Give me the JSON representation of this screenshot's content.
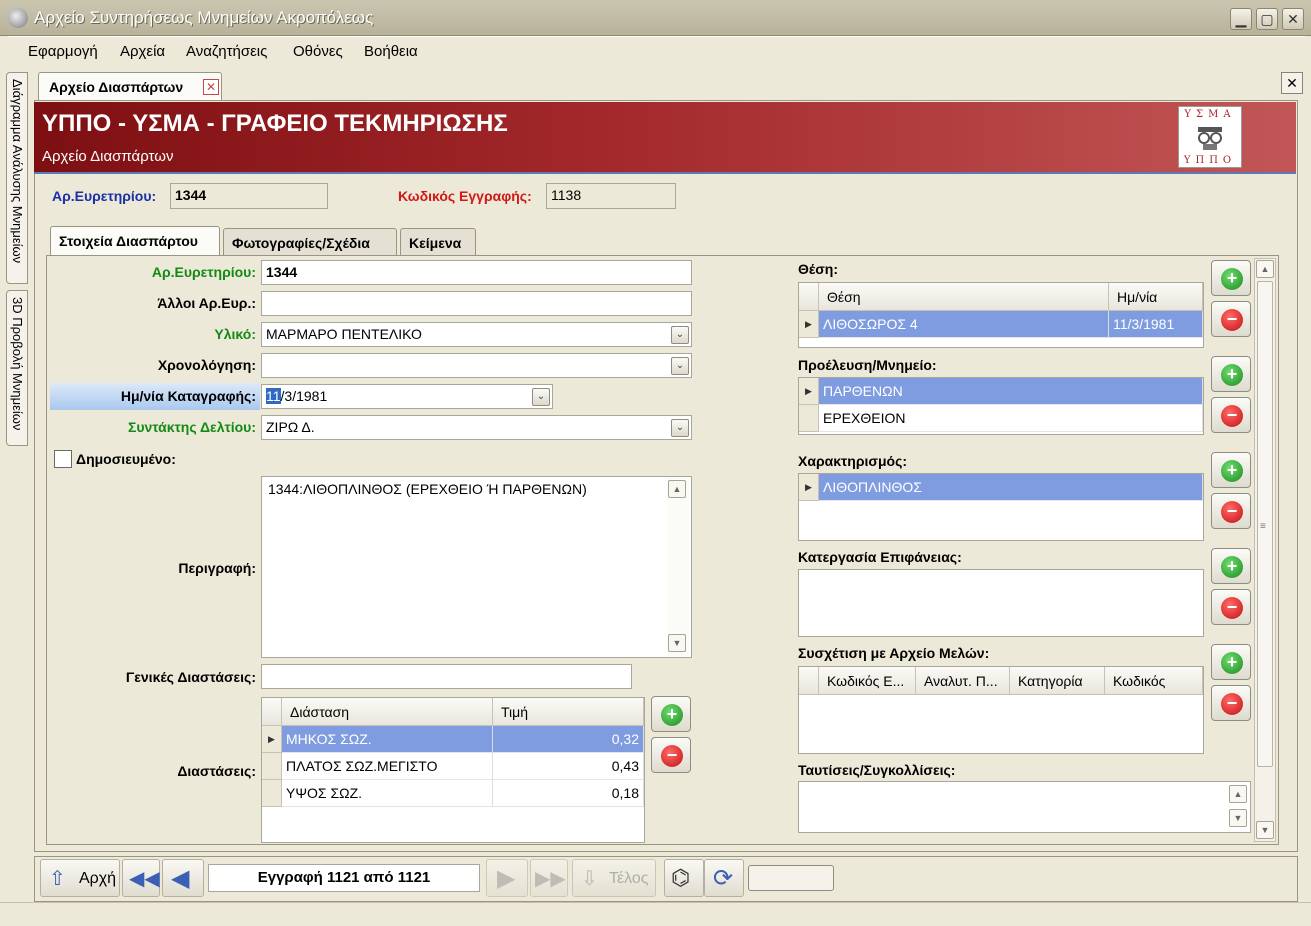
{
  "window": {
    "title": "Αρχείο Συντηρήσεως Μνημείων Ακροπόλεως",
    "minimize": "▁",
    "maximize": "▢",
    "close": "✕"
  },
  "menu": [
    "Εφαρμογή",
    "Αρχεία",
    "Αναζητήσεις",
    "Οθόνες",
    "Βοήθεια"
  ],
  "side_tabs": [
    "Διάγραμμα Ανάλυσης Μνημείων",
    "3D Προβολή Μνημείων"
  ],
  "doc_tab": {
    "label": "Αρχείο Διασπάρτων",
    "close": "✕"
  },
  "close_all": "✕",
  "banner": {
    "title": "ΥΠΠΟ - ΥΣΜΑ - ΓΡΑΦΕΙΟ ΤΕΚΜΗΡΙΩΣΗΣ",
    "subtitle": "Αρχείο Διασπάρτων",
    "logo_top": "ΥΣΜΑ",
    "logo_bottom": "ΥΠΠΟ"
  },
  "header_fields": {
    "inventory_label": "Αρ.Ευρετηρίου:",
    "inventory_value": "1344",
    "record_code_label": "Κωδικός Εγγραφής:",
    "record_code_value": "1138"
  },
  "tabs": [
    "Στοιχεία Διασπάρτου",
    "Φωτογραφίες/Σχέδια",
    "Κείμενα"
  ],
  "form": {
    "inventory_label": "Αρ.Ευρετηρίου:",
    "inventory_value": "1344",
    "other_inv_label": "Άλλοι Αρ.Ευρ.:",
    "other_inv_value": "",
    "material_label": "Υλικό:",
    "material_value": "ΜΑΡΜΑΡΟ ΠΕΝΤΕΛΙΚΟ",
    "dating_label": "Χρονολόγηση:",
    "dating_value": "",
    "date_label": "Ημ/νία Καταγραφής:",
    "date_sel": "11",
    "date_rest": "/3/1981",
    "author_label": "Συντάκτης Δελτίου:",
    "author_value": "ΖΙΡΩ Δ.",
    "published_label": "Δημοσιευμένο:",
    "description_label": "Περιγραφή:",
    "description_value": "1344:ΛΙΘΟΠΛΙΝΘΟΣ  (ΕΡΕΧΘΕΙΟ Ή ΠΑΡΘΕΝΩΝ)",
    "general_dims_label": "Γενικές Διαστάσεις:",
    "general_dims_value": "",
    "dims_label": "Διαστάσεις:"
  },
  "dims_table": {
    "headers": [
      "Διάσταση",
      "Τιμή"
    ],
    "rows": [
      {
        "name": "ΜΗΚΟΣ ΣΩΖ.",
        "value": "0,32"
      },
      {
        "name": "ΠΛΑΤΟΣ ΣΩΖ.ΜΕΓΙΣΤΟ",
        "value": "0,43"
      },
      {
        "name": "ΥΨΟΣ ΣΩΖ.",
        "value": "0,18"
      }
    ]
  },
  "right": {
    "position_label": "Θέση:",
    "position_headers": [
      "Θέση",
      "Ημ/νία"
    ],
    "position_row": {
      "place": "ΛΙΘΟΣΩΡΟΣ 4",
      "date": "11/3/1981"
    },
    "origin_label": "Προέλευση/Μνημείο:",
    "origin_rows": [
      "ΠΑΡΘΕΝΩΝ",
      "ΕΡΕΧΘΕΙΟΝ"
    ],
    "characterization_label": "Χαρακτηρισμός:",
    "characterization_rows": [
      "ΛΙΘΟΠΛΙΝΘΟΣ"
    ],
    "surface_label": "Κατεργασία Επιφάνειας:",
    "relation_label": "Συσχέτιση με Αρχείο Μελών:",
    "relation_headers": [
      "Κωδικός Ε...",
      "Αναλυτ. Π...",
      "Κατηγορία",
      "Κωδικός"
    ],
    "identification_label": "Ταυτίσεις/Συγκολλίσεις:"
  },
  "nav": {
    "first": "Αρχή",
    "record": "Εγγραφή 1121 από 1121",
    "last": "Τέλος"
  },
  "colors": {
    "banner_start": "#7d0f12",
    "banner_end": "#c25656",
    "selection": "#7f9ce0",
    "label_blue": "#1a2fa8",
    "label_red": "#d01818",
    "label_green": "#138a13"
  }
}
